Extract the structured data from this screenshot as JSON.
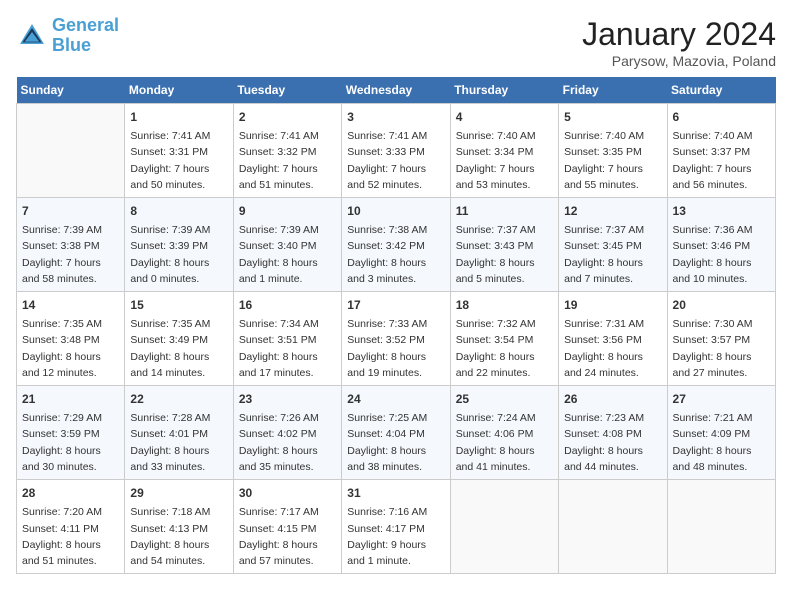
{
  "header": {
    "logo_line1": "General",
    "logo_line2": "Blue",
    "month": "January 2024",
    "location": "Parysow, Mazovia, Poland"
  },
  "weekdays": [
    "Sunday",
    "Monday",
    "Tuesday",
    "Wednesday",
    "Thursday",
    "Friday",
    "Saturday"
  ],
  "weeks": [
    [
      {
        "day": "",
        "info": ""
      },
      {
        "day": "1",
        "info": "Sunrise: 7:41 AM\nSunset: 3:31 PM\nDaylight: 7 hours\nand 50 minutes."
      },
      {
        "day": "2",
        "info": "Sunrise: 7:41 AM\nSunset: 3:32 PM\nDaylight: 7 hours\nand 51 minutes."
      },
      {
        "day": "3",
        "info": "Sunrise: 7:41 AM\nSunset: 3:33 PM\nDaylight: 7 hours\nand 52 minutes."
      },
      {
        "day": "4",
        "info": "Sunrise: 7:40 AM\nSunset: 3:34 PM\nDaylight: 7 hours\nand 53 minutes."
      },
      {
        "day": "5",
        "info": "Sunrise: 7:40 AM\nSunset: 3:35 PM\nDaylight: 7 hours\nand 55 minutes."
      },
      {
        "day": "6",
        "info": "Sunrise: 7:40 AM\nSunset: 3:37 PM\nDaylight: 7 hours\nand 56 minutes."
      }
    ],
    [
      {
        "day": "7",
        "info": "Sunrise: 7:39 AM\nSunset: 3:38 PM\nDaylight: 7 hours\nand 58 minutes."
      },
      {
        "day": "8",
        "info": "Sunrise: 7:39 AM\nSunset: 3:39 PM\nDaylight: 8 hours\nand 0 minutes."
      },
      {
        "day": "9",
        "info": "Sunrise: 7:39 AM\nSunset: 3:40 PM\nDaylight: 8 hours\nand 1 minute."
      },
      {
        "day": "10",
        "info": "Sunrise: 7:38 AM\nSunset: 3:42 PM\nDaylight: 8 hours\nand 3 minutes."
      },
      {
        "day": "11",
        "info": "Sunrise: 7:37 AM\nSunset: 3:43 PM\nDaylight: 8 hours\nand 5 minutes."
      },
      {
        "day": "12",
        "info": "Sunrise: 7:37 AM\nSunset: 3:45 PM\nDaylight: 8 hours\nand 7 minutes."
      },
      {
        "day": "13",
        "info": "Sunrise: 7:36 AM\nSunset: 3:46 PM\nDaylight: 8 hours\nand 10 minutes."
      }
    ],
    [
      {
        "day": "14",
        "info": "Sunrise: 7:35 AM\nSunset: 3:48 PM\nDaylight: 8 hours\nand 12 minutes."
      },
      {
        "day": "15",
        "info": "Sunrise: 7:35 AM\nSunset: 3:49 PM\nDaylight: 8 hours\nand 14 minutes."
      },
      {
        "day": "16",
        "info": "Sunrise: 7:34 AM\nSunset: 3:51 PM\nDaylight: 8 hours\nand 17 minutes."
      },
      {
        "day": "17",
        "info": "Sunrise: 7:33 AM\nSunset: 3:52 PM\nDaylight: 8 hours\nand 19 minutes."
      },
      {
        "day": "18",
        "info": "Sunrise: 7:32 AM\nSunset: 3:54 PM\nDaylight: 8 hours\nand 22 minutes."
      },
      {
        "day": "19",
        "info": "Sunrise: 7:31 AM\nSunset: 3:56 PM\nDaylight: 8 hours\nand 24 minutes."
      },
      {
        "day": "20",
        "info": "Sunrise: 7:30 AM\nSunset: 3:57 PM\nDaylight: 8 hours\nand 27 minutes."
      }
    ],
    [
      {
        "day": "21",
        "info": "Sunrise: 7:29 AM\nSunset: 3:59 PM\nDaylight: 8 hours\nand 30 minutes."
      },
      {
        "day": "22",
        "info": "Sunrise: 7:28 AM\nSunset: 4:01 PM\nDaylight: 8 hours\nand 33 minutes."
      },
      {
        "day": "23",
        "info": "Sunrise: 7:26 AM\nSunset: 4:02 PM\nDaylight: 8 hours\nand 35 minutes."
      },
      {
        "day": "24",
        "info": "Sunrise: 7:25 AM\nSunset: 4:04 PM\nDaylight: 8 hours\nand 38 minutes."
      },
      {
        "day": "25",
        "info": "Sunrise: 7:24 AM\nSunset: 4:06 PM\nDaylight: 8 hours\nand 41 minutes."
      },
      {
        "day": "26",
        "info": "Sunrise: 7:23 AM\nSunset: 4:08 PM\nDaylight: 8 hours\nand 44 minutes."
      },
      {
        "day": "27",
        "info": "Sunrise: 7:21 AM\nSunset: 4:09 PM\nDaylight: 8 hours\nand 48 minutes."
      }
    ],
    [
      {
        "day": "28",
        "info": "Sunrise: 7:20 AM\nSunset: 4:11 PM\nDaylight: 8 hours\nand 51 minutes."
      },
      {
        "day": "29",
        "info": "Sunrise: 7:18 AM\nSunset: 4:13 PM\nDaylight: 8 hours\nand 54 minutes."
      },
      {
        "day": "30",
        "info": "Sunrise: 7:17 AM\nSunset: 4:15 PM\nDaylight: 8 hours\nand 57 minutes."
      },
      {
        "day": "31",
        "info": "Sunrise: 7:16 AM\nSunset: 4:17 PM\nDaylight: 9 hours\nand 1 minute."
      },
      {
        "day": "",
        "info": ""
      },
      {
        "day": "",
        "info": ""
      },
      {
        "day": "",
        "info": ""
      }
    ]
  ]
}
